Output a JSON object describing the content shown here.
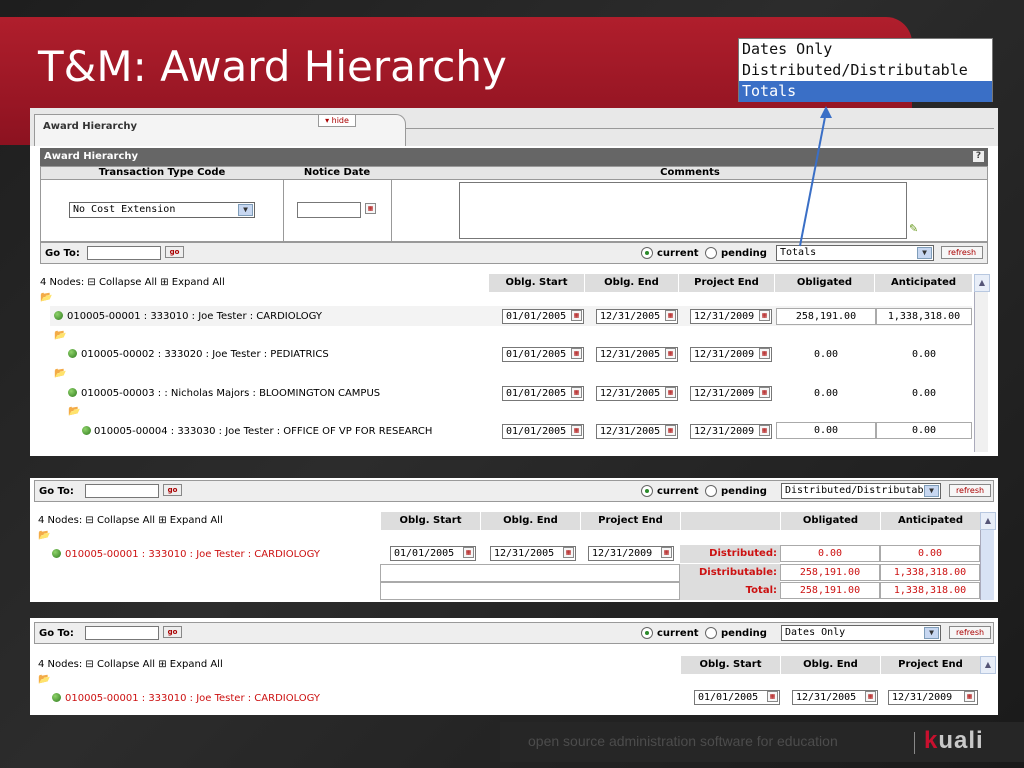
{
  "slide": {
    "title": "T&M: Award Hierarchy",
    "footer_text": "open source administration software for education",
    "logo_k": "k",
    "logo_rest": "uali"
  },
  "popup": {
    "options": [
      "Dates Only",
      "Distributed/Distributable",
      "Totals"
    ],
    "selected": "Totals"
  },
  "panel1": {
    "tab_title": "Award Hierarchy",
    "hide_label": "hide",
    "section_title": "Award Hierarchy",
    "help": "?",
    "headers": {
      "transaction_type": "Transaction Type Code",
      "notice_date": "Notice Date",
      "comments": "Comments"
    },
    "transaction_type_value": "No Cost Extension",
    "go_to_label": "Go To:",
    "go_label": "go",
    "current_label": "current",
    "pending_label": "pending",
    "view_select": "Totals",
    "refresh_label": "refresh",
    "tree_summary": "4 Nodes: ⊟ Collapse All ⊞ Expand All",
    "columns": [
      "Oblg. Start",
      "Oblg. End",
      "Project End",
      "Obligated",
      "Anticipated"
    ],
    "nodes": [
      {
        "label": "010005-00001 : 333010 : Joe Tester : CARDIOLOGY",
        "start": "01/01/2005",
        "end": "12/31/2005",
        "project_end": "12/31/2009",
        "obligated": "258,191.00",
        "anticipated": "1,338,318.00"
      },
      {
        "label": "010005-00002 : 333020 : Joe Tester : PEDIATRICS",
        "start": "01/01/2005",
        "end": "12/31/2005",
        "project_end": "12/31/2009",
        "obligated": "0.00",
        "anticipated": "0.00"
      },
      {
        "label": "010005-00003 : : Nicholas Majors : BLOOMINGTON CAMPUS",
        "start": "01/01/2005",
        "end": "12/31/2005",
        "project_end": "12/31/2009",
        "obligated": "0.00",
        "anticipated": "0.00"
      },
      {
        "label": "010005-00004 : 333030 : Joe Tester : OFFICE OF VP FOR RESEARCH",
        "start": "01/01/2005",
        "end": "12/31/2005",
        "project_end": "12/31/2009",
        "obligated": "0.00",
        "anticipated": "0.00"
      }
    ]
  },
  "panel2": {
    "go_to_label": "Go To:",
    "go_label": "go",
    "current_label": "current",
    "pending_label": "pending",
    "view_select": "Distributed/Distributable",
    "refresh_label": "refresh",
    "tree_summary": "4 Nodes: ⊟ Collapse All ⊞ Expand All",
    "columns": [
      "Oblg. Start",
      "Oblg. End",
      "Project End",
      "",
      "Obligated",
      "Anticipated"
    ],
    "node_label": "010005-00001 : 333010 : Joe Tester : CARDIOLOGY",
    "start": "01/01/2005",
    "end": "12/31/2005",
    "project_end": "12/31/2009",
    "rows": [
      {
        "label": "Distributed:",
        "obligated": "0.00",
        "anticipated": "0.00"
      },
      {
        "label": "Distributable:",
        "obligated": "258,191.00",
        "anticipated": "1,338,318.00"
      },
      {
        "label": "Total:",
        "obligated": "258,191.00",
        "anticipated": "1,338,318.00"
      }
    ]
  },
  "panel3": {
    "go_to_label": "Go To:",
    "go_label": "go",
    "current_label": "current",
    "pending_label": "pending",
    "view_select": "Dates Only",
    "refresh_label": "refresh",
    "tree_summary": "4 Nodes: ⊟ Collapse All ⊞ Expand All",
    "columns": [
      "Oblg. Start",
      "Oblg. End",
      "Project End"
    ],
    "node_label": "010005-00001 : 333010 : Joe Tester : CARDIOLOGY",
    "start": "01/01/2005",
    "end": "12/31/2005",
    "project_end": "12/31/2009"
  },
  "colors": {
    "banner_red": "#b01e2c",
    "select_blue": "#3a6fc6",
    "red_text": "#cc1111"
  },
  "icons": [
    "folder-icon",
    "node-icon",
    "calendar-icon",
    "help-icon",
    "pencil-icon",
    "dropdown-caret-icon",
    "scroll-up-icon"
  ]
}
